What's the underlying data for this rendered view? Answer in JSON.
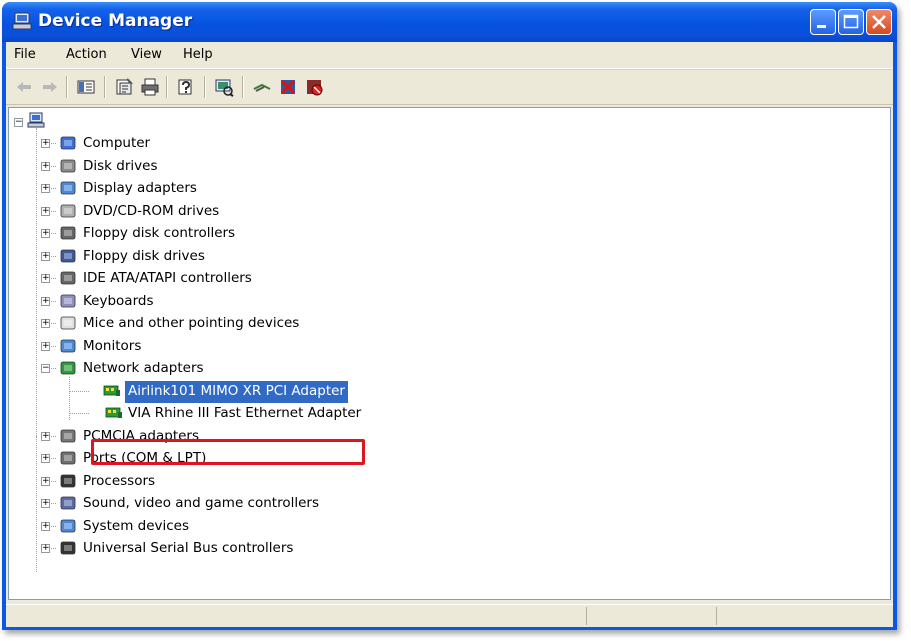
{
  "window": {
    "title": "Device Manager"
  },
  "menu": {
    "items": [
      "File",
      "Action",
      "View",
      "Help"
    ]
  },
  "toolbar": {
    "icons": [
      "back-arrow-icon",
      "forward-arrow-icon",
      "show-hide-console-tree-icon",
      "properties-icon",
      "print-icon",
      "help-icon",
      "scan-hardware-icon",
      "update-driver-icon",
      "uninstall-icon",
      "disable-icon"
    ]
  },
  "tree": {
    "root_icon": "computer-icon",
    "categories": [
      {
        "label": "Computer",
        "icon": "computer-icon"
      },
      {
        "label": "Disk drives",
        "icon": "disk-drive-icon"
      },
      {
        "label": "Display adapters",
        "icon": "display-adapter-icon"
      },
      {
        "label": "DVD/CD-ROM drives",
        "icon": "dvd-drive-icon"
      },
      {
        "label": "Floppy disk controllers",
        "icon": "floppy-controller-icon"
      },
      {
        "label": "Floppy disk drives",
        "icon": "floppy-drive-icon"
      },
      {
        "label": "IDE ATA/ATAPI controllers",
        "icon": "ide-controller-icon"
      },
      {
        "label": "Keyboards",
        "icon": "keyboard-icon"
      },
      {
        "label": "Mice and other pointing devices",
        "icon": "mouse-icon"
      },
      {
        "label": "Monitors",
        "icon": "monitor-icon"
      },
      {
        "label": "Network adapters",
        "icon": "network-adapter-icon",
        "expanded": true
      },
      {
        "label": "PCMCIA adapters",
        "icon": "pcmcia-icon"
      },
      {
        "label": "Ports (COM & LPT)",
        "icon": "port-icon"
      },
      {
        "label": "Processors",
        "icon": "processor-icon"
      },
      {
        "label": "Sound, video and game controllers",
        "icon": "sound-icon"
      },
      {
        "label": "System devices",
        "icon": "system-device-icon"
      },
      {
        "label": "Universal Serial Bus controllers",
        "icon": "usb-icon"
      }
    ],
    "network_children": [
      {
        "label": "Airlink101 MIMO XR PCI Adapter",
        "selected": true
      },
      {
        "label": "VIA Rhine III Fast Ethernet Adapter",
        "selected": false
      }
    ]
  },
  "colors": {
    "selection": "#316ac5",
    "highlight_box": "#e0141e",
    "titlebar": "#0553e0"
  }
}
